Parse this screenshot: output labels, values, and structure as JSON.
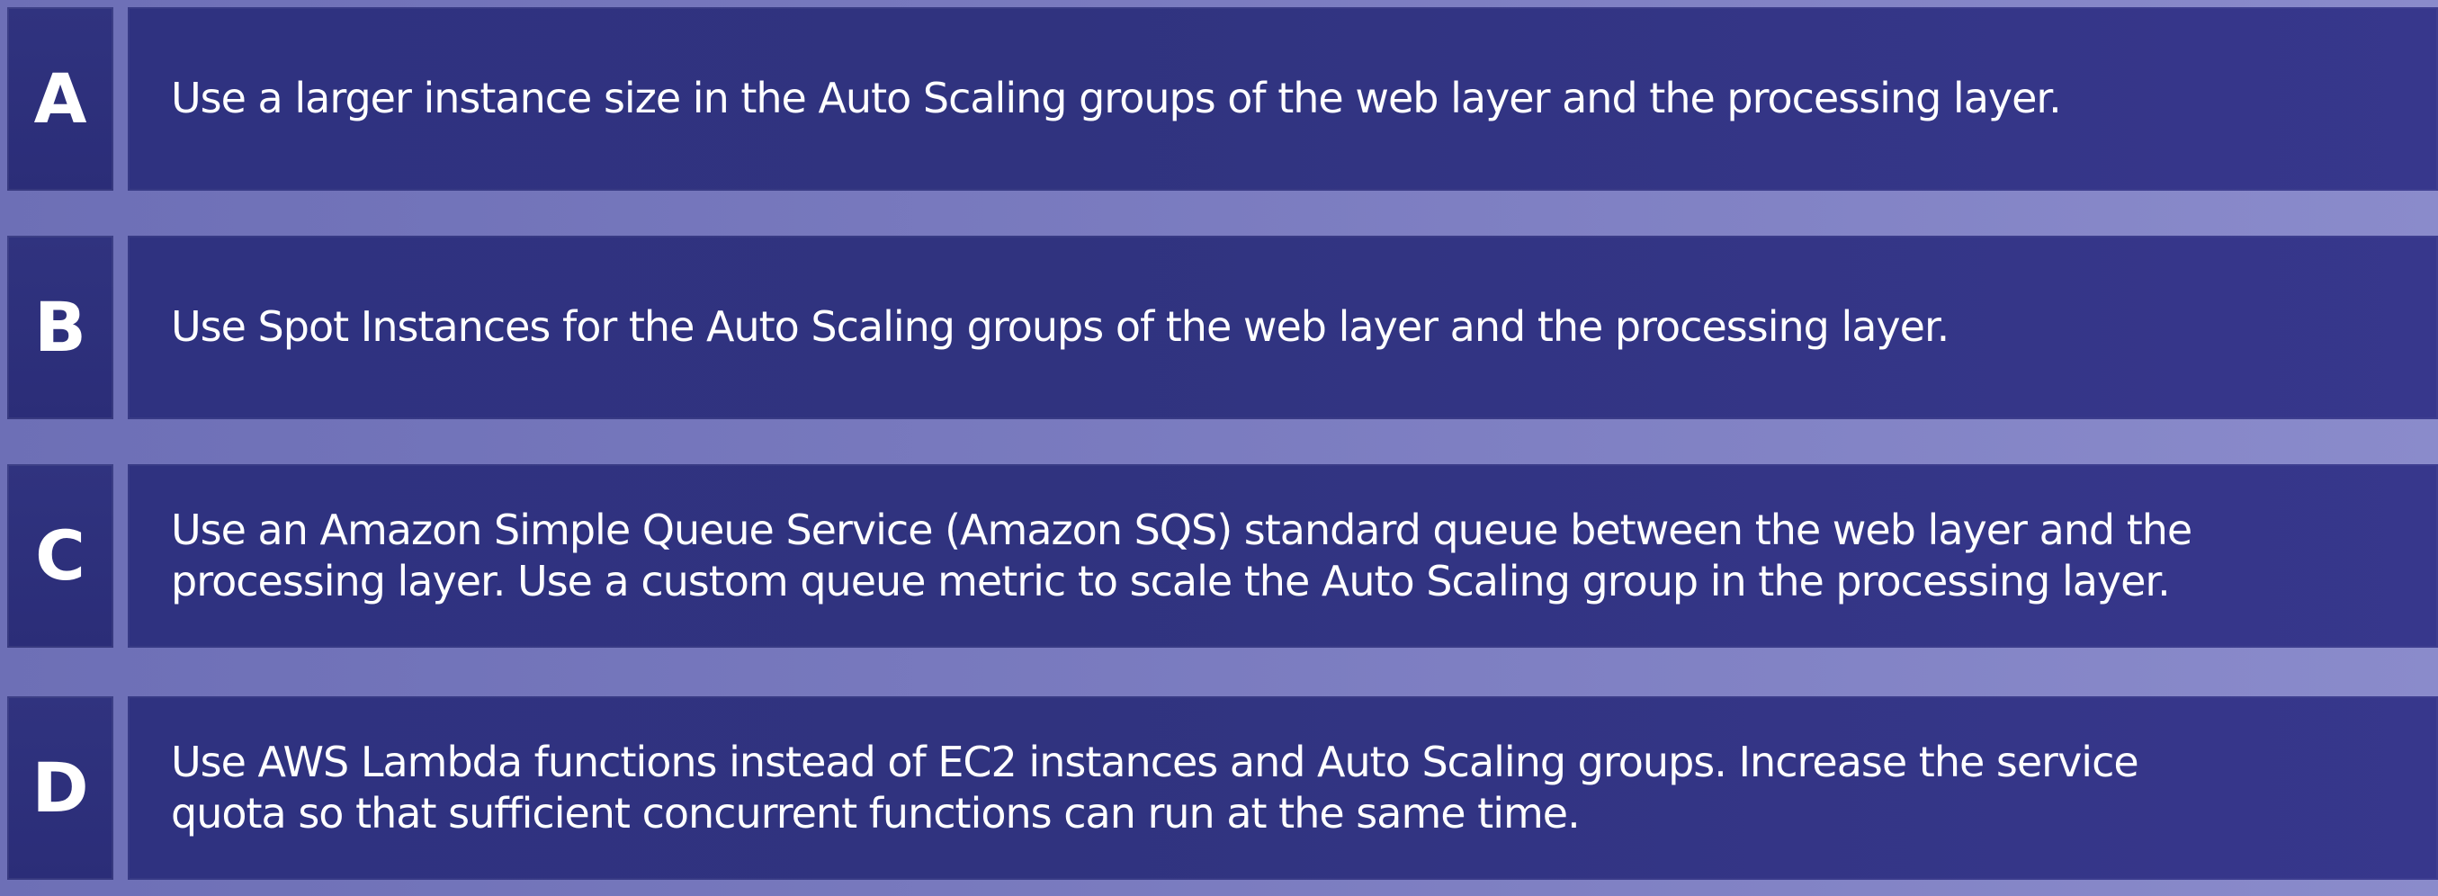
{
  "options": [
    {
      "letter": "A",
      "text": "Use a larger instance size in the Auto Scaling groups of the web layer and the processing layer."
    },
    {
      "letter": "B",
      "text": "Use Spot Instances for the Auto Scaling groups of the web layer and the processing layer."
    },
    {
      "letter": "C",
      "text": "Use an Amazon Simple Queue Service (Amazon SQS) standard queue between the web layer and the\nprocessing layer. Use a custom queue metric to scale the Auto Scaling group in the processing layer."
    },
    {
      "letter": "D",
      "text": "Use AWS Lambda functions instead of EC2 instances and Auto Scaling groups. Increase the service\nquota so that sufficient concurrent functions can run at the same time."
    }
  ]
}
